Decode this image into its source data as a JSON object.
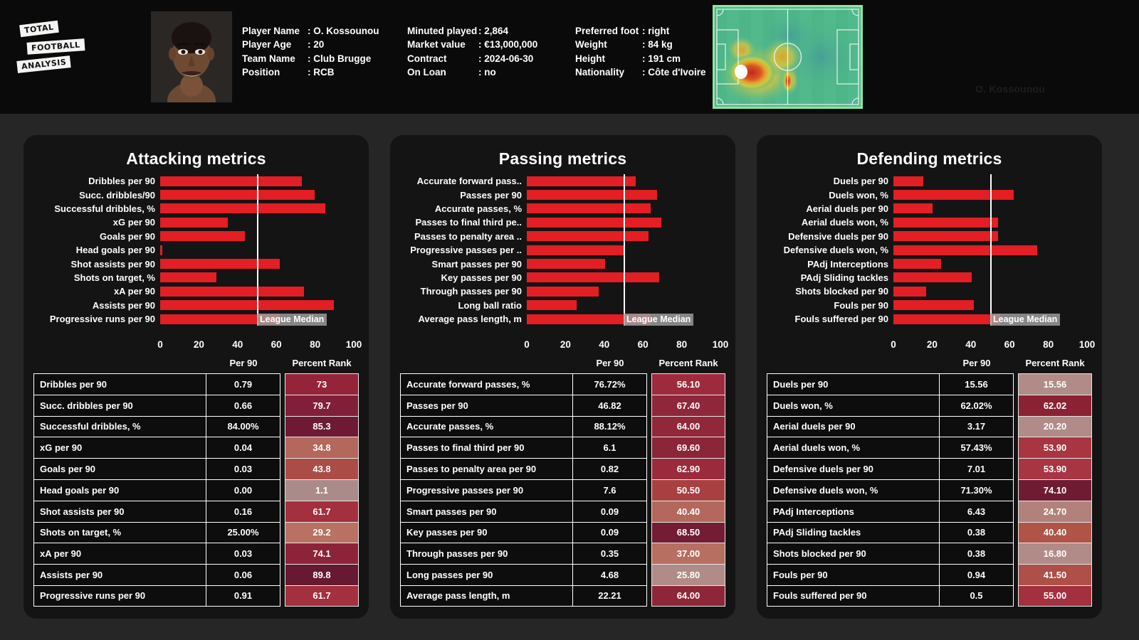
{
  "header": {
    "logo": {
      "line1": "TOTAL",
      "line2": "FOOTBALL",
      "line3": "ANALYSIS"
    },
    "watermark": "O. Kossounou",
    "photo_alt": "player-portrait",
    "info_col1": [
      {
        "key": "Player Name",
        "value": ": O. Kossounou"
      },
      {
        "key": "Player Age",
        "value": ": 20"
      },
      {
        "key": "Team Name",
        "value": ": Club Brugge"
      },
      {
        "key": "Position",
        "value": ": RCB"
      }
    ],
    "info_col2": [
      {
        "key": "Minuted played",
        "value": ": 2,864"
      },
      {
        "key": "Market value",
        "value": ": €13,000,000"
      },
      {
        "key": "Contract",
        "value": ": 2024-06-30"
      },
      {
        "key": "On Loan",
        "value": ": no"
      }
    ],
    "info_col3": [
      {
        "key": "Preferred foot",
        "value": ": right"
      },
      {
        "key": "Weight",
        "value": ": 84 kg"
      },
      {
        "key": "Height",
        "value": ": 191 cm"
      },
      {
        "key": "Nationality",
        "value": ": Côte d'Ivoire"
      }
    ]
  },
  "common": {
    "median_label": "League Median",
    "col_per90": "Per 90",
    "col_rank": "Percent Rank",
    "bar_color": "#e31e24",
    "median_color": "#ffffff",
    "axis_ticks": [
      "0",
      "20",
      "40",
      "60",
      "80",
      "100"
    ]
  },
  "chart_data": [
    {
      "type": "bar",
      "title": "Attacking metrics",
      "xlabel": "",
      "ylabel": "",
      "xlim": [
        0,
        100
      ],
      "median": 50,
      "grid": false,
      "legend": "League Median",
      "categories": [
        "Dribbles per 90",
        "Succ. dribbles/90",
        "Successful dribbles, %",
        "xG per 90",
        "Goals per 90",
        "Head goals per 90",
        "Shot assists per 90",
        "Shots on target, %",
        "xA per 90",
        "Assists per 90",
        "Progressive runs per 90"
      ],
      "values": [
        73,
        79.7,
        85.3,
        34.8,
        43.8,
        1.1,
        61.7,
        29.2,
        74.1,
        89.8,
        61.7
      ]
    },
    {
      "type": "bar",
      "title": "Passing metrics",
      "xlabel": "",
      "ylabel": "",
      "xlim": [
        0,
        100
      ],
      "median": 50,
      "grid": false,
      "legend": "League Median",
      "categories": [
        "Accurate forward pass..",
        "Passes per 90",
        "Accurate passes, %",
        "Passes to final third pe..",
        "Passes to penalty area ..",
        "Progressive passes per ..",
        "Smart passes per 90",
        "Key passes per 90",
        "Through passes per 90",
        "Long ball ratio",
        "Average pass length, m"
      ],
      "values": [
        56.1,
        67.4,
        64.0,
        69.6,
        62.9,
        50.5,
        40.4,
        68.5,
        37.0,
        25.8,
        64.0
      ]
    },
    {
      "type": "bar",
      "title": "Defending metrics",
      "xlabel": "",
      "ylabel": "",
      "xlim": [
        0,
        100
      ],
      "median": 50,
      "grid": false,
      "legend": "League Median",
      "categories": [
        "Duels per 90",
        "Duels won, %",
        "Aerial duels per 90",
        "Aerial duels won, %",
        "Defensive duels per 90",
        "Defensive duels won, %",
        "PAdj Interceptions",
        "PAdj Sliding tackles",
        "Shots blocked per 90",
        "Fouls per 90",
        "Fouls suffered per 90"
      ],
      "values": [
        15.56,
        62.02,
        20.2,
        53.9,
        53.9,
        74.1,
        24.7,
        40.4,
        16.8,
        41.5,
        55.0
      ]
    }
  ],
  "tables": [
    {
      "name": "attacking-table",
      "headers": [
        "",
        "Per 90",
        "Percent Rank"
      ],
      "rows": [
        {
          "metric": "Dribbles per 90",
          "per90": "0.79",
          "rank": "73",
          "color": "#95243b"
        },
        {
          "metric": "Succ. dribbles per 90",
          "per90": "0.66",
          "rank": "79.7",
          "color": "#811f38"
        },
        {
          "metric": "Successful dribbles, %",
          "per90": "84.00%",
          "rank": "85.3",
          "color": "#6e1a34"
        },
        {
          "metric": "xG per 90",
          "per90": "0.04",
          "rank": "34.8",
          "color": "#b4675c"
        },
        {
          "metric": "Goals per 90",
          "per90": "0.03",
          "rank": "43.8",
          "color": "#ac4c46"
        },
        {
          "metric": "Head goals per 90",
          "per90": "0.00",
          "rank": "1.1",
          "color": "#ab8b8a"
        },
        {
          "metric": "Shot assists per 90",
          "per90": "0.16",
          "rank": "61.7",
          "color": "#a3303e"
        },
        {
          "metric": "Shots on target, %",
          "per90": "25.00%",
          "rank": "29.2",
          "color": "#b87162"
        },
        {
          "metric": "xA per 90",
          "per90": "0.03",
          "rank": "74.1",
          "color": "#8d2339"
        },
        {
          "metric": "Assists per 90",
          "per90": "0.06",
          "rank": "89.8",
          "color": "#671832"
        },
        {
          "metric": "Progressive runs per 90",
          "per90": "0.91",
          "rank": "61.7",
          "color": "#a3303e"
        }
      ]
    },
    {
      "name": "passing-table",
      "headers": [
        "",
        "Per 90",
        "Percent Rank"
      ],
      "rows": [
        {
          "metric": "Accurate forward passes, %",
          "per90": "76.72%",
          "rank": "56.10",
          "color": "#9d2b3d"
        },
        {
          "metric": "Passes per 90",
          "per90": "46.82",
          "rank": "67.40",
          "color": "#8f2639"
        },
        {
          "metric": "Accurate passes, %",
          "per90": "88.12%",
          "rank": "64.00",
          "color": "#93273a"
        },
        {
          "metric": "Passes to final third per 90",
          "per90": "6.1",
          "rank": "69.60",
          "color": "#8b2538"
        },
        {
          "metric": "Passes to penalty area per 90",
          "per90": "0.82",
          "rank": "62.90",
          "color": "#9a2a3c"
        },
        {
          "metric": "Progressive passes per 90",
          "per90": "7.6",
          "rank": "50.50",
          "color": "#a84041"
        },
        {
          "metric": "Smart passes per 90",
          "per90": "0.09",
          "rank": "40.40",
          "color": "#b4685d"
        },
        {
          "metric": "Key passes per 90",
          "per90": "0.09",
          "rank": "68.50",
          "color": "#731c34"
        },
        {
          "metric": "Through passes per 90",
          "per90": "0.35",
          "rank": "37.00",
          "color": "#b66f60"
        },
        {
          "metric": "Long passes per 90",
          "per90": "4.68",
          "rank": "25.80",
          "color": "#b08b87"
        },
        {
          "metric": "Average pass length, m",
          "per90": "22.21",
          "rank": "64.00",
          "color": "#8e2639"
        }
      ]
    },
    {
      "name": "defending-table",
      "headers": [
        "",
        "Per 90",
        "Percent Rank"
      ],
      "rows": [
        {
          "metric": "Duels per 90",
          "per90": "15.56",
          "rank": "15.56",
          "color": "#b08b87"
        },
        {
          "metric": "Duels won, %",
          "per90": "62.02%",
          "rank": "62.02",
          "color": "#8b2233"
        },
        {
          "metric": "Aerial duels per 90",
          "per90": "3.17",
          "rank": "20.20",
          "color": "#b08b87"
        },
        {
          "metric": "Aerial duels won, %",
          "per90": "57.43%",
          "rank": "53.90",
          "color": "#a83542"
        },
        {
          "metric": "Defensive duels per 90",
          "per90": "7.01",
          "rank": "53.90",
          "color": "#a83542"
        },
        {
          "metric": "Defensive duels won, %",
          "per90": "71.30%",
          "rank": "74.10",
          "color": "#6f1c33"
        },
        {
          "metric": "PAdj Interceptions",
          "per90": "6.43",
          "rank": "24.70",
          "color": "#b3817c"
        },
        {
          "metric": "PAdj Sliding tackles",
          "per90": "0.38",
          "rank": "40.40",
          "color": "#b05447"
        },
        {
          "metric": "Shots blocked per 90",
          "per90": "0.38",
          "rank": "16.80",
          "color": "#b08b87"
        },
        {
          "metric": "Fouls per 90",
          "per90": "0.94",
          "rank": "41.50",
          "color": "#ae5048"
        },
        {
          "metric": "Fouls suffered per 90",
          "per90": "0.5",
          "rank": "55.00",
          "color": "#a3303e"
        }
      ]
    }
  ]
}
